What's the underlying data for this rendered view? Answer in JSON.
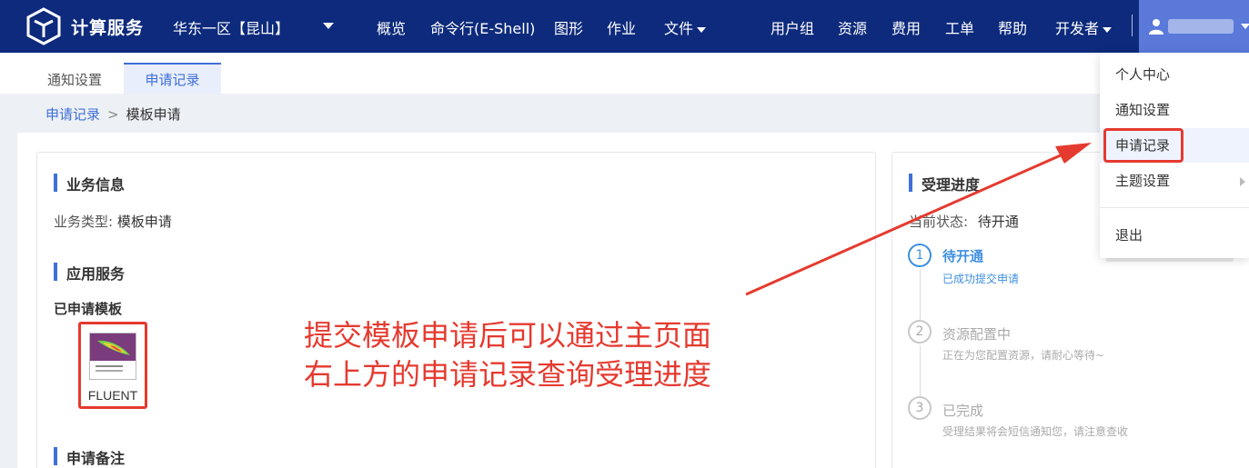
{
  "header": {
    "logo_text": "计算服务",
    "region": "华东一区【昆山】",
    "nav": [
      "概览",
      "命令行(E-Shell)",
      "图形",
      "作业",
      "文件"
    ],
    "right_nav": [
      "用户组",
      "资源",
      "费用",
      "工单",
      "帮助",
      "开发者"
    ]
  },
  "tabs": [
    "通知设置",
    "申请记录"
  ],
  "breadcrumb": {
    "parent": "申请记录",
    "separator": ">",
    "current": "模板申请"
  },
  "business": {
    "section_title": "业务信息",
    "type_label": "业务类型:",
    "type_value": "模板申请"
  },
  "app_service": {
    "section_title": "应用服务",
    "applied_label": "已申请模板",
    "template_name": "FLUENT"
  },
  "remarks": {
    "section_title": "申请备注"
  },
  "annotation": {
    "line1": "提交模板申请后可以通过主页面",
    "line2": "右上方的申请记录查询受理进度"
  },
  "progress": {
    "section_title": "受理进度",
    "status_label": "当前状态:",
    "status_value": "待开通",
    "steps": [
      {
        "num": "1",
        "title": "待开通",
        "desc": "已成功提交申请"
      },
      {
        "num": "2",
        "title": "资源配置中",
        "desc": "正在为您配置资源，请耐心等待~"
      },
      {
        "num": "3",
        "title": "已完成",
        "desc": "受理结果将会短信通知您，请注意查收"
      }
    ]
  },
  "user_menu": {
    "items": [
      "个人中心",
      "通知设置",
      "申请记录",
      "主题设置",
      "退出"
    ]
  },
  "colors": {
    "nav_bg": "#0d2a7c",
    "accent": "#3f6fd8",
    "highlight_red": "#e53a2f"
  }
}
